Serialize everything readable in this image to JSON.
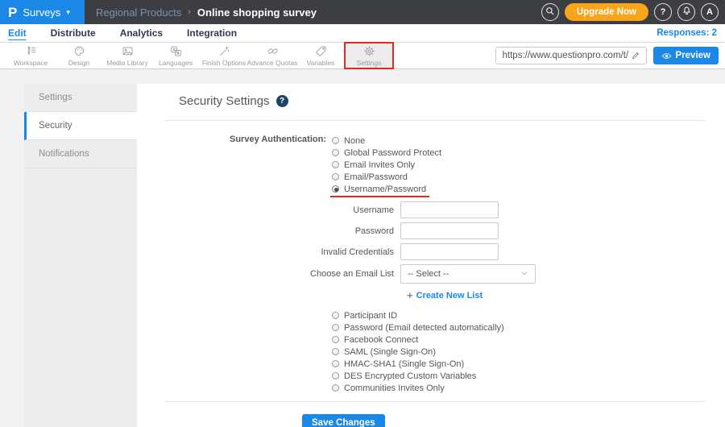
{
  "topbar": {
    "logo_letter": "P",
    "menu_label": "Surveys",
    "caret": "▾",
    "breadcrumb": {
      "parent": "Regional Products",
      "separator": "›",
      "current": "Online shopping survey"
    },
    "upgrade_label": "Upgrade Now",
    "help_glyph": "?",
    "avatar_glyph": "A"
  },
  "tab_bar": {
    "tabs": [
      {
        "label": "Edit",
        "active": true
      },
      {
        "label": "Distribute"
      },
      {
        "label": "Analytics"
      },
      {
        "label": "Integration"
      }
    ],
    "responses_label": "Responses: 2"
  },
  "toolbar": {
    "items": [
      {
        "label": "Workspace",
        "icon": "workspace-icon"
      },
      {
        "label": "Design",
        "icon": "design-icon"
      },
      {
        "label": "Media Library",
        "icon": "media-library-icon"
      },
      {
        "label": "Languages",
        "icon": "languages-icon"
      },
      {
        "label": "Finish Options",
        "icon": "finish-options-icon"
      },
      {
        "label": "Advance Quotas",
        "icon": "advance-quotas-icon"
      },
      {
        "label": "Variables",
        "icon": "variables-icon"
      },
      {
        "label": "Settings",
        "icon": "settings-icon",
        "active": true,
        "annotated": true
      }
    ],
    "survey_url": "https://www.questionpro.com/t/APNrFZ",
    "preview_label": "Preview"
  },
  "sidebar": {
    "items": [
      {
        "label": "Settings"
      },
      {
        "label": "Security",
        "active": true
      },
      {
        "label": "Notifications"
      }
    ]
  },
  "main": {
    "title": "Security Settings",
    "help_glyph": "?",
    "auth_label": "Survey Authentication:",
    "auth_options_top": [
      {
        "label": "None"
      },
      {
        "label": "Global Password Protect"
      },
      {
        "label": "Email Invites Only"
      },
      {
        "label": "Email/Password"
      },
      {
        "label": "Username/Password",
        "selected": true,
        "underlined": true
      }
    ],
    "fields": [
      {
        "label": "Username",
        "type": "text",
        "value": ""
      },
      {
        "label": "Password",
        "type": "text",
        "value": ""
      },
      {
        "label": "Invalid Credentials",
        "type": "text",
        "value": ""
      },
      {
        "label": "Choose an Email List",
        "type": "select",
        "value": "-- Select --"
      }
    ],
    "create_list": {
      "plus": "+",
      "label": "Create New List"
    },
    "auth_options_bottom": [
      {
        "label": "Participant ID"
      },
      {
        "label": "Password (Email detected automatically)"
      },
      {
        "label": "Facebook Connect"
      },
      {
        "label": "SAML (Single Sign-On)"
      },
      {
        "label": "HMAC-SHA1 (Single Sign-On)"
      },
      {
        "label": "DES Encrypted Custom Variables"
      },
      {
        "label": "Communities Invites Only"
      }
    ],
    "save_label": "Save Changes"
  },
  "colors": {
    "brand_blue": "#1b87e6",
    "topbar_dark": "#3d3e42",
    "upgrade_orange": "#f9a51b",
    "annotation_red": "#e02b20",
    "link_blue": "#1b87e6"
  }
}
